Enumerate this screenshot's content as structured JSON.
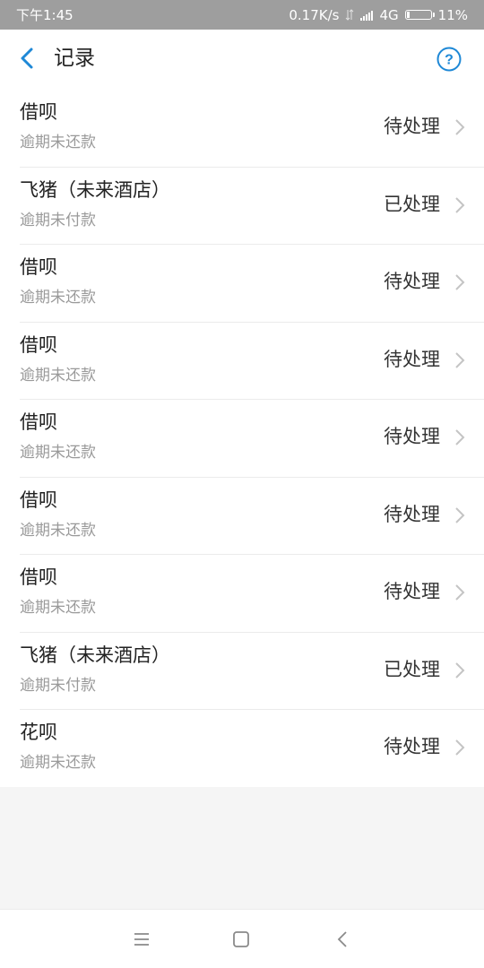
{
  "status_bar": {
    "time": "下午1:45",
    "speed": "0.17K/s",
    "network": "4G",
    "battery": "11%",
    "battery_level": 0.11
  },
  "header": {
    "title": "记录",
    "back_icon": "chevron-left-icon",
    "help_icon": "question-circle-icon",
    "accent_color": "#1e88d6"
  },
  "records": [
    {
      "title": "借呗",
      "subtitle": "逾期未还款",
      "status": "待处理"
    },
    {
      "title": "飞猪（未来酒店）",
      "subtitle": "逾期未付款",
      "status": "已处理"
    },
    {
      "title": "借呗",
      "subtitle": "逾期未还款",
      "status": "待处理"
    },
    {
      "title": "借呗",
      "subtitle": "逾期未还款",
      "status": "待处理"
    },
    {
      "title": "借呗",
      "subtitle": "逾期未还款",
      "status": "待处理"
    },
    {
      "title": "借呗",
      "subtitle": "逾期未还款",
      "status": "待处理"
    },
    {
      "title": "借呗",
      "subtitle": "逾期未还款",
      "status": "待处理"
    },
    {
      "title": "飞猪（未来酒店）",
      "subtitle": "逾期未付款",
      "status": "已处理"
    },
    {
      "title": "花呗",
      "subtitle": "逾期未还款",
      "status": "待处理"
    }
  ],
  "nav_bar": {
    "menu_icon": "menu-icon",
    "home_icon": "home-square-icon",
    "back_icon": "back-arrow-icon"
  }
}
